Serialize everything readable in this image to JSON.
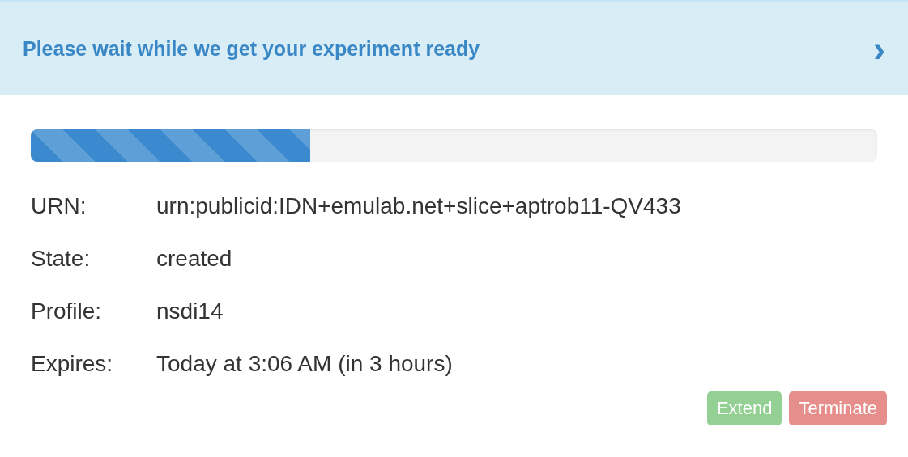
{
  "banner": {
    "title": "Please wait while we get your experiment ready",
    "icon": "›"
  },
  "progress": {
    "level": 0.33
  },
  "details": [
    {
      "label": "URN:",
      "value": "urn:publicid:IDN+emulab.net+slice+aptrob11-QV433"
    },
    {
      "label": "State:",
      "value": "created"
    },
    {
      "label": "Profile:",
      "value": "nsdi14"
    },
    {
      "label": "Expires:",
      "value": "Today at 3:06 AM (in 3 hours)"
    }
  ],
  "buttons": [
    {
      "label": "Extend",
      "kind": "success",
      "disabled": true
    },
    {
      "label": "Terminate",
      "kind": "danger",
      "disabled": true
    }
  ]
}
